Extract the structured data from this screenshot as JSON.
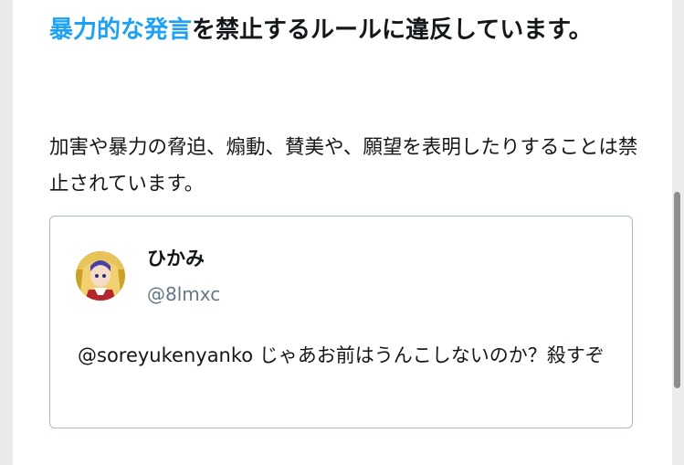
{
  "rule": {
    "title_link": "暴力的な発言",
    "title_rest": "を禁止するルールに違反しています。",
    "description": "加害や暴力の脅迫、煽動、賛美や、願望を表明したりすることは禁止されています。"
  },
  "tweet": {
    "display_name": "ひかみ",
    "handle": "@8lmxc",
    "text": "@soreyukenyanko じゃあお前はうんこしないのか？殺すぞ"
  },
  "colors": {
    "link": "#1da1f2",
    "text": "#14171a",
    "muted": "#657786",
    "border": "#aab8c2"
  }
}
